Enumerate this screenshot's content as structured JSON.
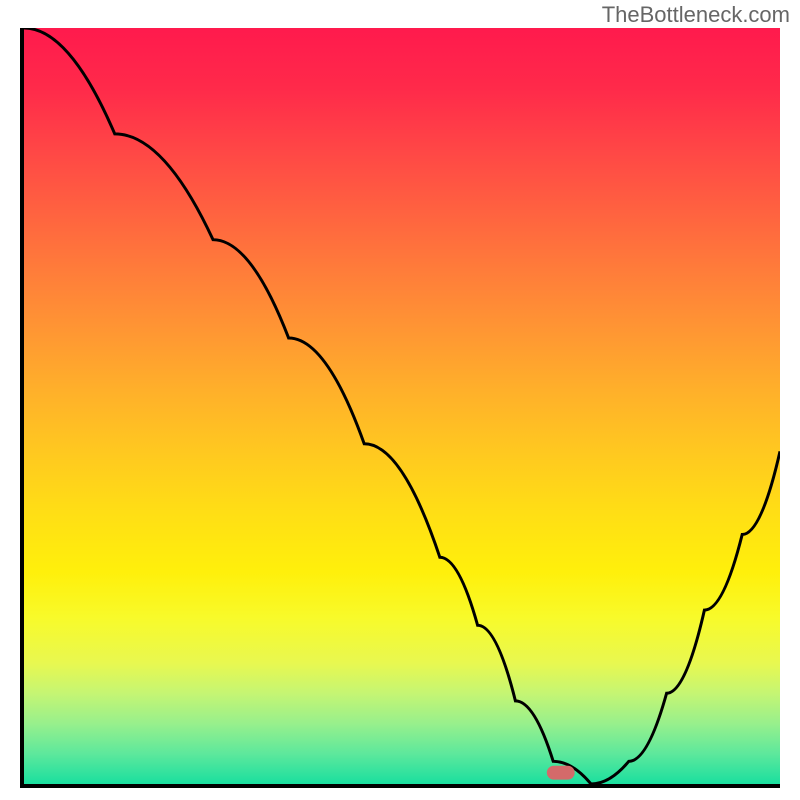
{
  "watermark": "TheBottleneck.com",
  "chart_data": {
    "type": "line",
    "title": "",
    "xlabel": "",
    "ylabel": "",
    "xlim": [
      0,
      100
    ],
    "ylim": [
      0,
      100
    ],
    "grid": false,
    "legend": false,
    "annotations": [],
    "series": [
      {
        "name": "curve",
        "x": [
          0,
          12,
          25,
          35,
          45,
          55,
          60,
          65,
          70,
          75,
          80,
          85,
          90,
          95,
          100
        ],
        "y": [
          100,
          86,
          72,
          59,
          45,
          30,
          21,
          11,
          3,
          0,
          3,
          12,
          23,
          33,
          44
        ]
      }
    ],
    "marker": {
      "x": 71,
      "y": 1.5,
      "shape": "rounded-rect",
      "color": "#d46a6a"
    },
    "background": "rainbow-vertical",
    "line_color": "#000000",
    "line_width": 3
  }
}
